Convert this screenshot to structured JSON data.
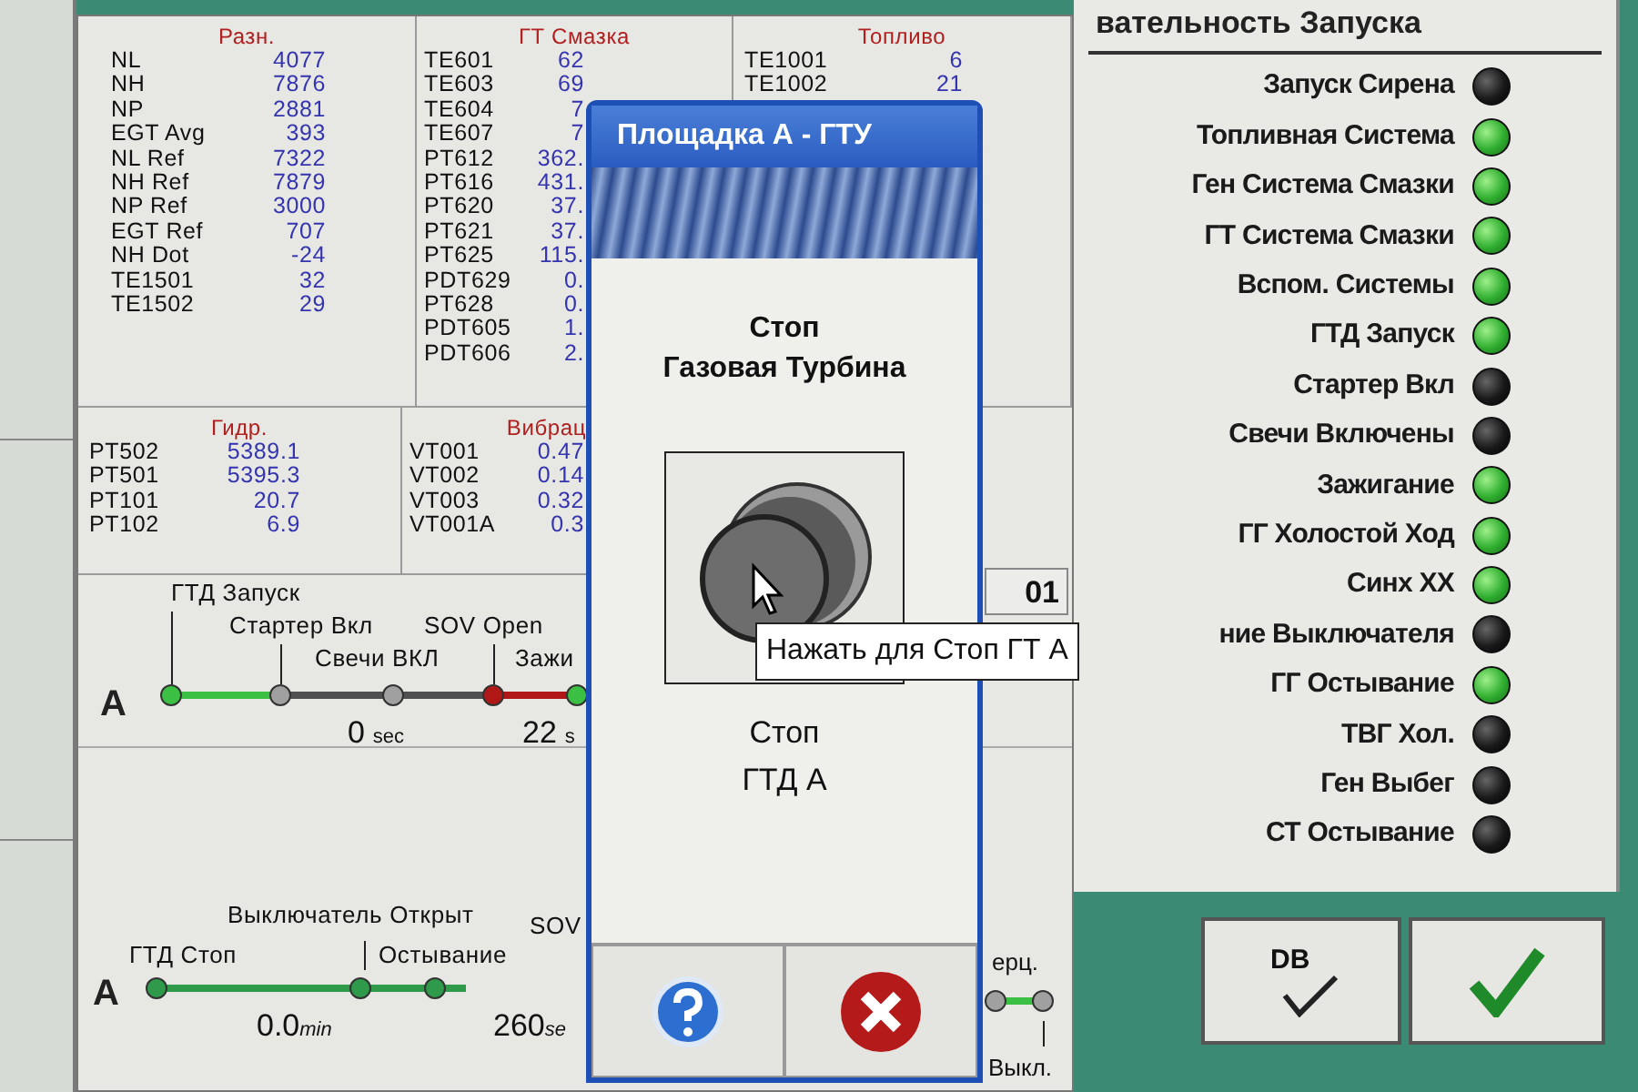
{
  "tables_top": [
    {
      "title": "Разн.",
      "rows": [
        {
          "label": "NL",
          "value": "4077"
        },
        {
          "label": "NH",
          "value": "7876"
        },
        {
          "label": "NP",
          "value": "2881"
        },
        {
          "label": "EGT Avg",
          "value": "393"
        },
        {
          "label": "NL Ref",
          "value": "7322"
        },
        {
          "label": "NH Ref",
          "value": "7879"
        },
        {
          "label": "NP Ref",
          "value": "3000"
        },
        {
          "label": "EGT Ref",
          "value": "707"
        },
        {
          "label": "NH Dot",
          "value": "-24"
        },
        {
          "label": "TE1501",
          "value": "32"
        },
        {
          "label": "TE1502",
          "value": "29"
        }
      ]
    },
    {
      "title": "ГТ Смазка",
      "rows": [
        {
          "label": "TE601",
          "value": "62"
        },
        {
          "label": "TE603",
          "value": "69"
        },
        {
          "label": "TE604",
          "value": "7"
        },
        {
          "label": "TE607",
          "value": "7"
        },
        {
          "label": "PT612",
          "value": "362."
        },
        {
          "label": "PT616",
          "value": "431."
        },
        {
          "label": "PT620",
          "value": "37."
        },
        {
          "label": "PT621",
          "value": "37."
        },
        {
          "label": "PT625",
          "value": "115."
        },
        {
          "label": "PDT629",
          "value": "0."
        },
        {
          "label": "PT628",
          "value": "0."
        },
        {
          "label": "PDT605",
          "value": "1."
        },
        {
          "label": "PDT606",
          "value": "2."
        }
      ]
    },
    {
      "title": "Топливо",
      "rows": [
        {
          "label": "TE1001",
          "value": "6"
        },
        {
          "label": "TE1002",
          "value": "21"
        }
      ]
    }
  ],
  "tables_bottom": [
    {
      "title": "Гидр.",
      "rows": [
        {
          "label": "PT502",
          "value": "5389.1"
        },
        {
          "label": "PT501",
          "value": "5395.3"
        },
        {
          "label": "PT101",
          "value": "20.7"
        },
        {
          "label": "PT102",
          "value": "6.9"
        }
      ]
    },
    {
      "title": "Вибрац",
      "rows": [
        {
          "label": "VT001",
          "value": "0.47"
        },
        {
          "label": "VT002",
          "value": "0.14"
        },
        {
          "label": "VT003",
          "value": "0.32"
        },
        {
          "label": "VT001A",
          "value": "0.3"
        }
      ]
    }
  ],
  "timeline_start": {
    "row_label": "A",
    "cell": "01",
    "labels": [
      "ГТД Запуск",
      "Стартер Вкл",
      "SOV Open",
      "Свечи ВКЛ",
      "Зажи"
    ],
    "nodes": [
      {
        "color": "#3cc043"
      },
      {
        "color": "#a0a0a0"
      },
      {
        "color": "#a0a0a0"
      },
      {
        "color": "#b01818"
      },
      {
        "color": "#3cc043"
      }
    ],
    "readings": [
      {
        "value": "0",
        "unit": "sec"
      },
      {
        "value": "22",
        "unit": "s"
      }
    ]
  },
  "timeline_stop": {
    "row_label": "A",
    "labels": [
      "Выключатель Открыт",
      "SOV",
      "ГТД Стоп",
      "Остывание"
    ],
    "nodes": [
      {
        "color": "#2e9a4a"
      },
      {
        "color": "#2e9a4a"
      },
      {
        "color": "#2e9a4a"
      }
    ],
    "readings": [
      {
        "value": "0.0",
        "unit": "min"
      },
      {
        "value": "260",
        "unit": "se"
      }
    ],
    "right_labels": [
      "ерц.",
      "Выкл."
    ],
    "right_nodes": [
      {
        "color": "#a0a0a0"
      },
      {
        "color": "#a0a0a0"
      }
    ]
  },
  "status_panel": {
    "title": "вательность Запуска",
    "items": [
      {
        "label": "Запуск Сирена",
        "on": false
      },
      {
        "label": "Топливная Система",
        "on": true
      },
      {
        "label": "Ген Система Смазки",
        "on": true
      },
      {
        "label": "ГТ Система Смазки",
        "on": true
      },
      {
        "label": "Вспом. Системы",
        "on": true
      },
      {
        "label": "ГТД Запуск",
        "on": true
      },
      {
        "label": "Стартер Вкл",
        "on": false
      },
      {
        "label": "Свечи Включены",
        "on": false
      },
      {
        "label": "Зажигание",
        "on": true
      },
      {
        "label": "ГГ Холостой Ход",
        "on": true
      },
      {
        "label": "Синх ХХ",
        "on": true
      },
      {
        "label": "ние Выключателя",
        "on": false
      },
      {
        "label": "ГГ Остывание",
        "on": true
      },
      {
        "label": "ТВГ Хол.",
        "on": false
      },
      {
        "label": "Ген Выбег",
        "on": false
      },
      {
        "label": "СТ Остывание",
        "on": false
      }
    ],
    "buttons": [
      {
        "kind": "db_check",
        "label": "DB"
      },
      {
        "kind": "check"
      }
    ]
  },
  "dialog": {
    "title": "Площадка А - ГТУ",
    "heading": [
      "Стоп",
      "Газовая Турбина"
    ],
    "caption": [
      "Стоп",
      "ГТД А"
    ],
    "tooltip": "Нажать для Стоп ГТ А",
    "buttons": [
      {
        "kind": "help"
      },
      {
        "kind": "cancel"
      }
    ]
  }
}
